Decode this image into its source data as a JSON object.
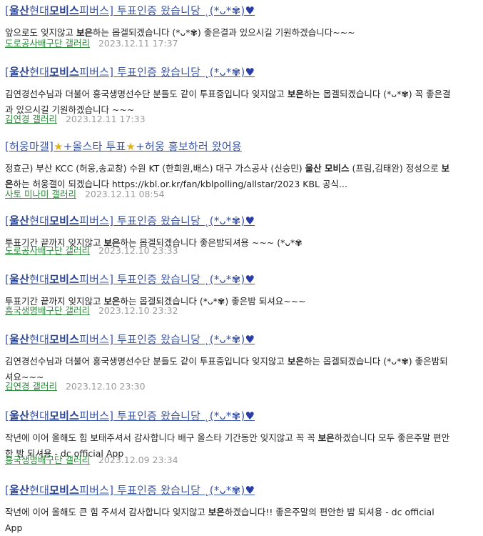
{
  "results": [
    {
      "title": [
        {
          "t": "[",
          "b": false
        },
        {
          "t": "울산",
          "b": true
        },
        {
          "t": "현대",
          "b": false
        },
        {
          "t": "모비스",
          "b": true
        },
        {
          "t": "피버스] 투표인증 왔습니당 ",
          "b": false
        },
        {
          "t": "˛(*ᴗ*✾)",
          "b": false
        },
        {
          "t": "♥",
          "b": false,
          "heart": true
        }
      ],
      "body": [
        {
          "t": "앞으로도 잊지않고 ",
          "b": false
        },
        {
          "t": "보은",
          "b": true
        },
        {
          "t": "하는 몹겔되겠습니다 (*ᴗ*✾) 좋은결과 있으시길 기원하겠습니다~~~",
          "b": false
        }
      ],
      "gallery": "도로공사배구단 갤러리",
      "date": "2023.12.11 17:37"
    },
    {
      "title": [
        {
          "t": "[",
          "b": false
        },
        {
          "t": "울산",
          "b": true
        },
        {
          "t": "현대",
          "b": false
        },
        {
          "t": "모비스",
          "b": true
        },
        {
          "t": "피버스] 투표인증 왔습니당 ",
          "b": false
        },
        {
          "t": "˛(*ᴗ*✾)",
          "b": false
        },
        {
          "t": "♥",
          "b": false,
          "heart": true
        }
      ],
      "body": [
        {
          "t": "김연경선수님과 더불어 흥국생명선수단 분들도 같이 투표중입니다 잊지않고 ",
          "b": false
        },
        {
          "t": "보은",
          "b": true
        },
        {
          "t": "하는 몹겔되겠습니다 (*ᴗ*✾) 꼭 좋은결과 있으시길 기원하겠습니다 ~~~",
          "b": false
        }
      ],
      "gallery": "김연경 갤러리",
      "date": "2023.12.11 17:33"
    },
    {
      "title": [
        {
          "t": "[허웅마갤]",
          "b": false
        },
        {
          "t": "★",
          "b": false,
          "star": true
        },
        {
          "t": "+올스타 투표",
          "b": false
        },
        {
          "t": "★",
          "b": false,
          "star": true
        },
        {
          "t": "+허웅 홍보하러 왔어용",
          "b": false
        }
      ],
      "body": [
        {
          "t": "정효근) 부산 KCC (허웅,송교창) 수원 KT (한희원,배스) 대구 가스공사 (신승민) ",
          "b": false
        },
        {
          "t": "울산 모비스",
          "b": true
        },
        {
          "t": " (프림,김태완) 정성으로 ",
          "b": false
        },
        {
          "t": "보은",
          "b": true
        },
        {
          "t": "하는 허웅갤이 되겠습니다 https://kbl.or.kr/fan/kblpolling/allstar/2023 KBL 공식...",
          "b": false
        }
      ],
      "gallery": "사토 미나미 갤러리",
      "date": "2023.12.11 08:54"
    },
    {
      "title": [
        {
          "t": "[",
          "b": false
        },
        {
          "t": "울산",
          "b": true
        },
        {
          "t": "현대",
          "b": false
        },
        {
          "t": "모비스",
          "b": true
        },
        {
          "t": "피버스] 투표인증 왔습니당 ",
          "b": false
        },
        {
          "t": "˛(*ᴗ*✾)",
          "b": false
        },
        {
          "t": "♥",
          "b": false,
          "heart": true
        }
      ],
      "body": [
        {
          "t": "투표기간 끝까지 잊지않고 ",
          "b": false
        },
        {
          "t": "보은",
          "b": true
        },
        {
          "t": "하는 몹겔되겠습니다 좋은밤되셔용 ~~~ (*ᴗ*✾",
          "b": false
        }
      ],
      "gallery": "도로공사배구단 갤러리",
      "date": "2023.12.10 23:33"
    },
    {
      "title": [
        {
          "t": "[",
          "b": false
        },
        {
          "t": "울산",
          "b": true
        },
        {
          "t": "현대",
          "b": false
        },
        {
          "t": "모비스",
          "b": true
        },
        {
          "t": "피버스] 투표인증 왔습니당 ",
          "b": false
        },
        {
          "t": "˛(*ᴗ*✾)",
          "b": false
        },
        {
          "t": "♥",
          "b": false,
          "heart": true
        }
      ],
      "body": [
        {
          "t": "투표기간 끝까지 잊지않고 ",
          "b": false
        },
        {
          "t": "보은",
          "b": true
        },
        {
          "t": "하는 몹겔되겠습니다 (*ᴗ*✾) 좋은밤 되셔요~~~",
          "b": false
        }
      ],
      "gallery": "흥국생명배구단 갤러리",
      "date": "2023.12.10 23:32"
    },
    {
      "title": [
        {
          "t": "[",
          "b": false
        },
        {
          "t": "울산",
          "b": true
        },
        {
          "t": "현대",
          "b": false
        },
        {
          "t": "모비스",
          "b": true
        },
        {
          "t": "피버스] 투표인증 왔습니당 ",
          "b": false
        },
        {
          "t": "˛(*ᴗ*✾)",
          "b": false
        },
        {
          "t": "♥",
          "b": false,
          "heart": true
        }
      ],
      "body": [
        {
          "t": "김연경선수님과 더불어 흥국생명선수단 분들도 같이 투표중입니다 잊지않고 ",
          "b": false
        },
        {
          "t": "보은",
          "b": true
        },
        {
          "t": "하는 몹겔되겠습니다 (*ᴗ*✾) 좋은밤되셔요~~~",
          "b": false
        }
      ],
      "gallery": "김연경 갤러리",
      "date": "2023.12.10 23:30"
    },
    {
      "title": [
        {
          "t": "[",
          "b": false
        },
        {
          "t": "울산",
          "b": true
        },
        {
          "t": "현대",
          "b": false
        },
        {
          "t": "모비스",
          "b": true
        },
        {
          "t": "피버스] 투표인증 왔습니당 ",
          "b": false
        },
        {
          "t": "˛(*ᴗ*✾)",
          "b": false
        },
        {
          "t": "♥",
          "b": false,
          "heart": true
        }
      ],
      "body": [
        {
          "t": "작년에 이어 올해도 힘 보태주셔서 감사합니다 배구 올스타 기간동안 잊지않고 꼭 꼭 ",
          "b": false
        },
        {
          "t": "보은",
          "b": true
        },
        {
          "t": "하겠습니다 모두 좋은주말 편안한 밤 되셔용 - dc official App",
          "b": false
        }
      ],
      "gallery": "흥국생명배구단 갤러리",
      "date": "2023.12.09 23:34"
    },
    {
      "title": [
        {
          "t": "[",
          "b": false
        },
        {
          "t": "울산",
          "b": true
        },
        {
          "t": "현대",
          "b": false
        },
        {
          "t": "모비스",
          "b": true
        },
        {
          "t": "피버스] 투표인증 왔습니당 ",
          "b": false
        },
        {
          "t": "˛(*ᴗ*✾)",
          "b": false
        },
        {
          "t": "♥",
          "b": false,
          "heart": true
        }
      ],
      "body": [
        {
          "t": "작년에 이어 올해도 큰 힘 주셔서 감사합니다 잊지않고 ",
          "b": false
        },
        {
          "t": "보은",
          "b": true
        },
        {
          "t": "하겠습니다!! 좋은주말의 편안한 밤 되셔용 - dc official App",
          "b": false
        }
      ],
      "gallery": "",
      "date": ""
    }
  ]
}
